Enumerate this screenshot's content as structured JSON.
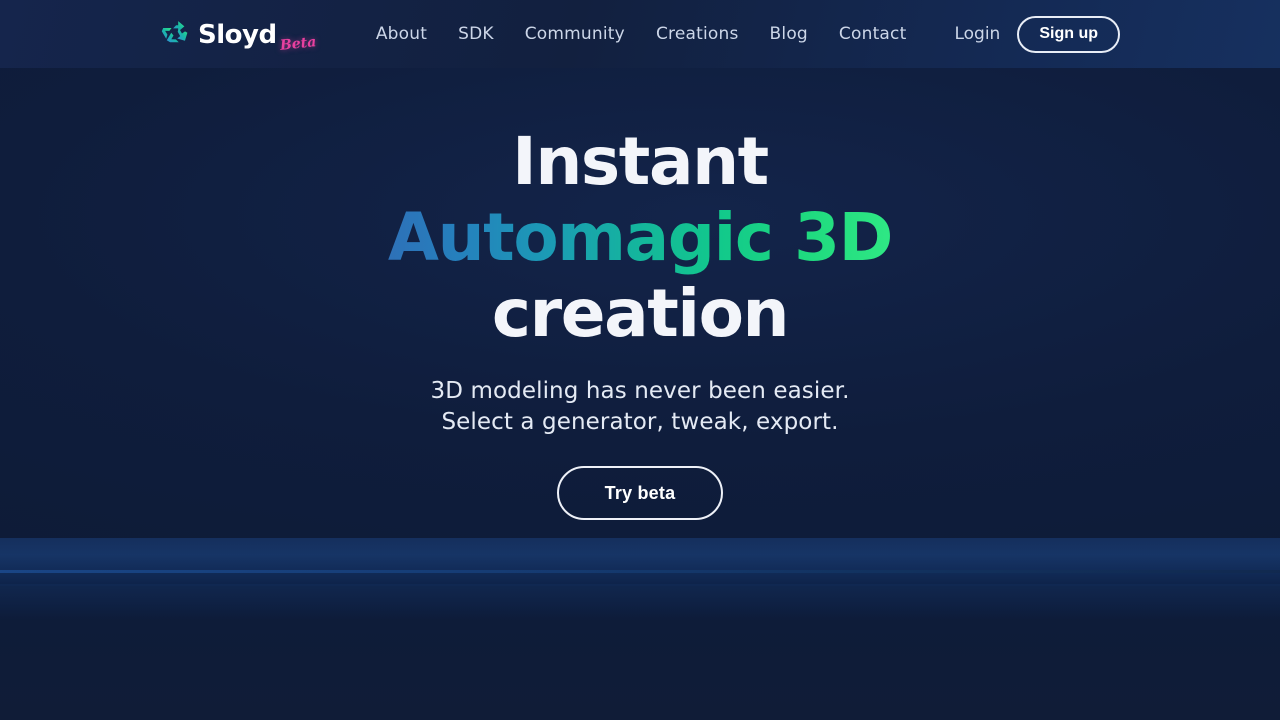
{
  "brand": {
    "name": "Sloyd",
    "badge": "Beta",
    "logo_icon": "sloyd-recycle-arrows-icon",
    "logo_gradient_from": "#2f9fe0",
    "logo_gradient_to": "#2fe884"
  },
  "nav": {
    "items": [
      {
        "label": "About"
      },
      {
        "label": "SDK"
      },
      {
        "label": "Community"
      },
      {
        "label": "Creations"
      },
      {
        "label": "Blog"
      },
      {
        "label": "Contact"
      }
    ]
  },
  "auth": {
    "login_label": "Login",
    "signup_label": "Sign up"
  },
  "hero": {
    "headline_line1": "Instant",
    "headline_line2": "Automagic 3D",
    "headline_line3": "creation",
    "subtitle_line1": "3D modeling has never been easier.",
    "subtitle_line2": "Select a generator, tweak, export.",
    "cta_label": "Try beta"
  },
  "colors": {
    "page_bg": "#0d1a35",
    "header_bg": "#13234a",
    "headline_white": "#f3f5fa",
    "gradient_start": "#2e71b8",
    "gradient_mid": "#14b69c",
    "gradient_end": "#2fe884",
    "nav_text": "#ccd6e8",
    "beta_pink": "#e8409f",
    "band_blue": "#16305e"
  }
}
